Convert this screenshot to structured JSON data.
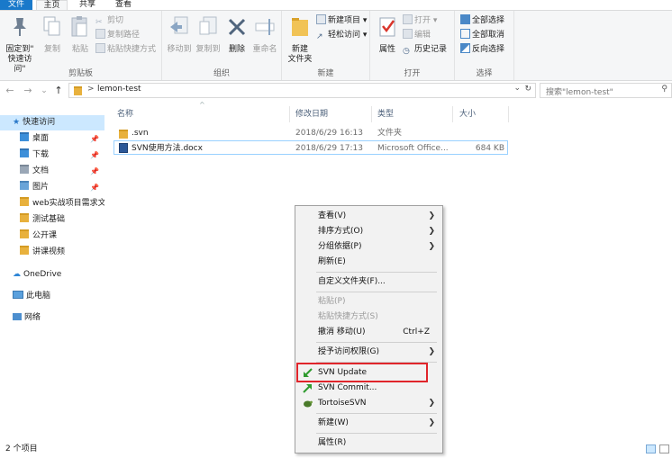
{
  "tabs": {
    "file": "文件",
    "home": "主页",
    "share": "共享",
    "view": "查看"
  },
  "ribbon": {
    "clipboard": {
      "label": "剪贴板",
      "pin": "固定到\"\n快速访问\"",
      "pin_line1": "固定到\"",
      "pin_line2": "快速访问\"",
      "copy": "复制",
      "paste": "粘贴",
      "cut": "剪切",
      "copy_path": "复制路径",
      "paste_shortcut": "粘贴快捷方式"
    },
    "organize": {
      "label": "组织",
      "move_to": "移动到",
      "copy_to": "复制到",
      "delete": "删除",
      "rename": "重命名"
    },
    "new": {
      "label": "新建",
      "new_folder_line1": "新建",
      "new_folder_line2": "文件夹",
      "new_item": "新建项目 ▾",
      "easy_access": "轻松访问 ▾"
    },
    "open": {
      "label": "打开",
      "properties": "属性",
      "open": "打开 ▾",
      "edit": "编辑",
      "history": "历史记录"
    },
    "select": {
      "label": "选择",
      "select_all": "全部选择",
      "select_none": "全部取消",
      "invert": "反向选择"
    }
  },
  "address": {
    "back": "←",
    "forward": "→",
    "recent": "⌄",
    "up": "↑",
    "separator": ">",
    "path": "lemon-test",
    "dropdown": "⌄",
    "refresh": "↻",
    "search_placeholder": "搜索\"lemon-test\"",
    "search_icon": "⚲"
  },
  "nav": {
    "quick_access": "快速访问",
    "items": [
      {
        "label": "桌面",
        "pinned": "📌"
      },
      {
        "label": "下载",
        "pinned": "📌"
      },
      {
        "label": "文档",
        "pinned": "📌"
      },
      {
        "label": "图片",
        "pinned": "📌"
      },
      {
        "label": "web实战项目需求文"
      },
      {
        "label": "测试基础"
      },
      {
        "label": "公开课"
      },
      {
        "label": "讲课视频"
      }
    ],
    "onedrive": "OneDrive",
    "this_pc": "此电脑",
    "network": "网络"
  },
  "files": {
    "sort_indicator": "^",
    "headers": {
      "name": "名称",
      "modified": "修改日期",
      "type": "类型",
      "size": "大小"
    },
    "rows": [
      {
        "name": ".svn",
        "modified": "2018/6/29 16:13",
        "type": "文件夹",
        "size": ""
      },
      {
        "name": "SVN使用方法.docx",
        "modified": "2018/6/29 17:13",
        "type": "Microsoft Office...",
        "size": "684 KB"
      }
    ]
  },
  "context_menu": {
    "view": "查看(V)",
    "sort_by": "排序方式(O)",
    "group_by": "分组依据(P)",
    "refresh": "刷新(E)",
    "customize": "自定义文件夹(F)...",
    "paste": "粘贴(P)",
    "paste_shortcut": "粘贴快捷方式(S)",
    "undo_move": "撤消 移动(U)",
    "undo_shortcut": "Ctrl+Z",
    "give_access": "授予访问权限(G)",
    "svn_update": "SVN Update",
    "svn_commit": "SVN Commit...",
    "tortoise_svn": "TortoiseSVN",
    "new": "新建(W)",
    "properties": "属性(R)",
    "submenu_arrow": "❯"
  },
  "status": {
    "item_count": "2 个项目"
  },
  "colors": {
    "accent": "#1979ca",
    "selection": "#cce8ff",
    "highlight_box": "#e0252b"
  }
}
